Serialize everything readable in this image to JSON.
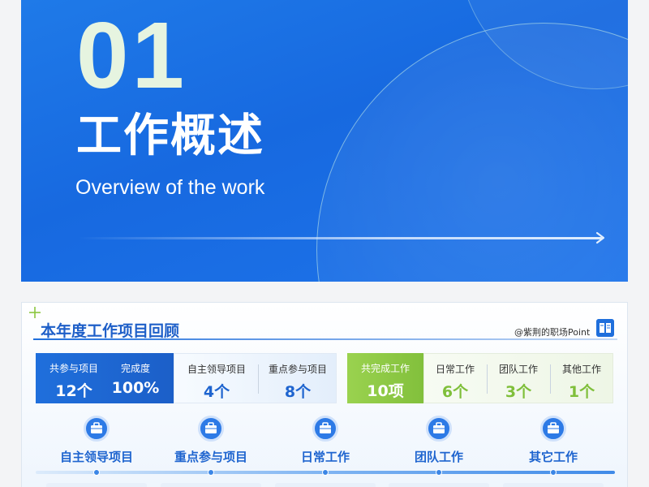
{
  "cover": {
    "number": "01",
    "title": "工作概述",
    "subtitle": "Overview of the work"
  },
  "review": {
    "title": "本年度工作项目回顾",
    "watermark": "@紫荆的职场Point",
    "participated": {
      "label": "共参与项目",
      "value": "12个",
      "completion_label": "完成度",
      "completion_value": "100%"
    },
    "project_stats": [
      {
        "label": "自主领导项目",
        "value": "4个"
      },
      {
        "label": "重点参与项目",
        "value": "8个"
      }
    ],
    "completed": {
      "label": "共完成工作",
      "value": "10项"
    },
    "work_stats": [
      {
        "label": "日常工作",
        "value": "6个"
      },
      {
        "label": "团队工作",
        "value": "3个"
      },
      {
        "label": "其他工作",
        "value": "1个"
      }
    ],
    "categories": [
      {
        "label": "自主领导项目",
        "icon": "briefcase-icon"
      },
      {
        "label": "重点参与项目",
        "icon": "briefcase-icon"
      },
      {
        "label": "日常工作",
        "icon": "briefcase-icon"
      },
      {
        "label": "团队工作",
        "icon": "briefcase-icon"
      },
      {
        "label": "其它工作",
        "icon": "briefcase-icon"
      }
    ]
  },
  "colors": {
    "primary_blue": "#1f6fdc",
    "accent_green": "#8cc63f",
    "number_tint": "#e6f4e0"
  }
}
